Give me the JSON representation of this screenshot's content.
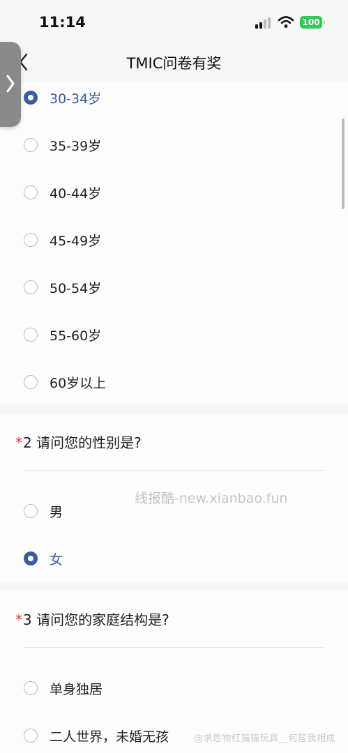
{
  "status_bar": {
    "time": "11:14",
    "battery": "100",
    "icons": [
      "signal-icon",
      "wifi-icon",
      "battery-icon"
    ]
  },
  "nav": {
    "title": "TMIC问卷有奖",
    "back_icon": "chevron-left-icon"
  },
  "side_tab": {
    "icon": "chevron-right-icon"
  },
  "question1_options": [
    {
      "label": "30-34岁",
      "selected": true
    },
    {
      "label": "35-39岁",
      "selected": false
    },
    {
      "label": "40-44岁",
      "selected": false
    },
    {
      "label": "45-49岁",
      "selected": false
    },
    {
      "label": "50-54岁",
      "selected": false
    },
    {
      "label": "55-60岁",
      "selected": false
    },
    {
      "label": "60岁以上",
      "selected": false
    }
  ],
  "question2": {
    "required_mark": "*",
    "title": "2 请问您的性别是?",
    "options": [
      {
        "label": "男",
        "selected": false
      },
      {
        "label": "女",
        "selected": true
      }
    ]
  },
  "question3": {
    "required_mark": "*",
    "title": "3 请问您的家庭结构是?",
    "options": [
      {
        "label": "单身独居",
        "selected": false
      },
      {
        "label": "二人世界，未婚无孩",
        "selected": false
      }
    ]
  },
  "watermark": "线报酷-new.xianbao.fun",
  "footer_watermark": "@求恩物红猫猫玩具__何居我相成",
  "colors": {
    "accent": "#3a5d9c",
    "required": "#e2313b",
    "battery": "#34c759"
  }
}
